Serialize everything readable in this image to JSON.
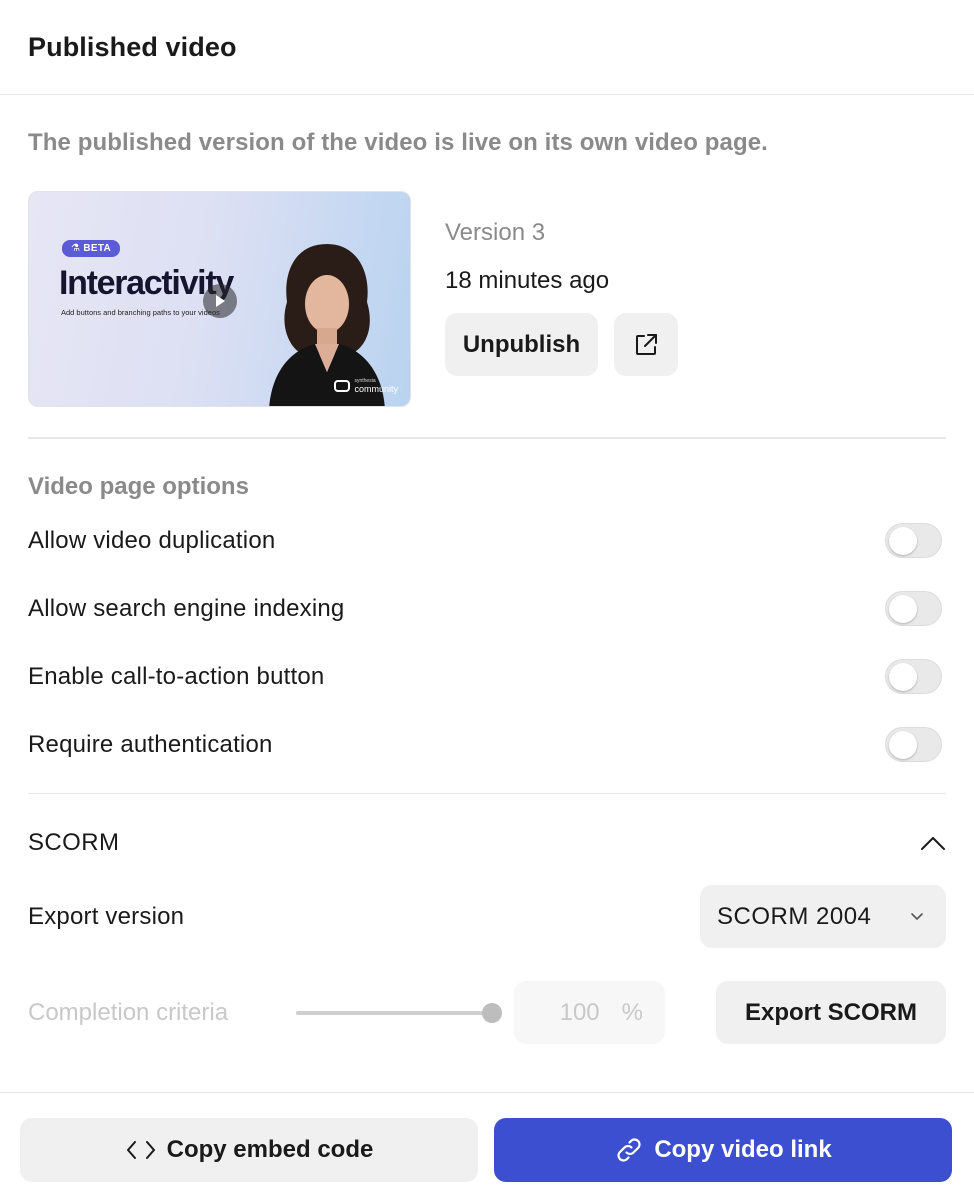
{
  "header": {
    "title": "Published video"
  },
  "intro": "The published version of the video is live on its own video page.",
  "thumbnail": {
    "badge": "BETA",
    "title": "Interactivity",
    "subtitle": "Add buttons and branching paths to your videos",
    "brand_top": "synthesia",
    "brand": "community"
  },
  "version": {
    "label": "Version 3",
    "time": "18 minutes ago",
    "unpublish_label": "Unpublish",
    "open_icon": "external-link-icon"
  },
  "options": {
    "title": "Video page options",
    "items": [
      {
        "label": "Allow video duplication",
        "enabled": false
      },
      {
        "label": "Allow search engine indexing",
        "enabled": false
      },
      {
        "label": "Enable call-to-action button",
        "enabled": false
      },
      {
        "label": "Require authentication",
        "enabled": false
      }
    ]
  },
  "scorm": {
    "title": "SCORM",
    "expanded": true,
    "export_version_label": "Export version",
    "export_version_value": "SCORM 2004",
    "completion_label": "Completion criteria",
    "completion_value": "100",
    "completion_unit": "%",
    "completion_fraction": 1.0,
    "export_button": "Export SCORM"
  },
  "footer": {
    "embed_label": "Copy embed code",
    "link_label": "Copy video link"
  },
  "colors": {
    "primary": "#3b4fd0",
    "muted_text": "#8a8a8a",
    "button_bg": "#f0f0f0"
  }
}
